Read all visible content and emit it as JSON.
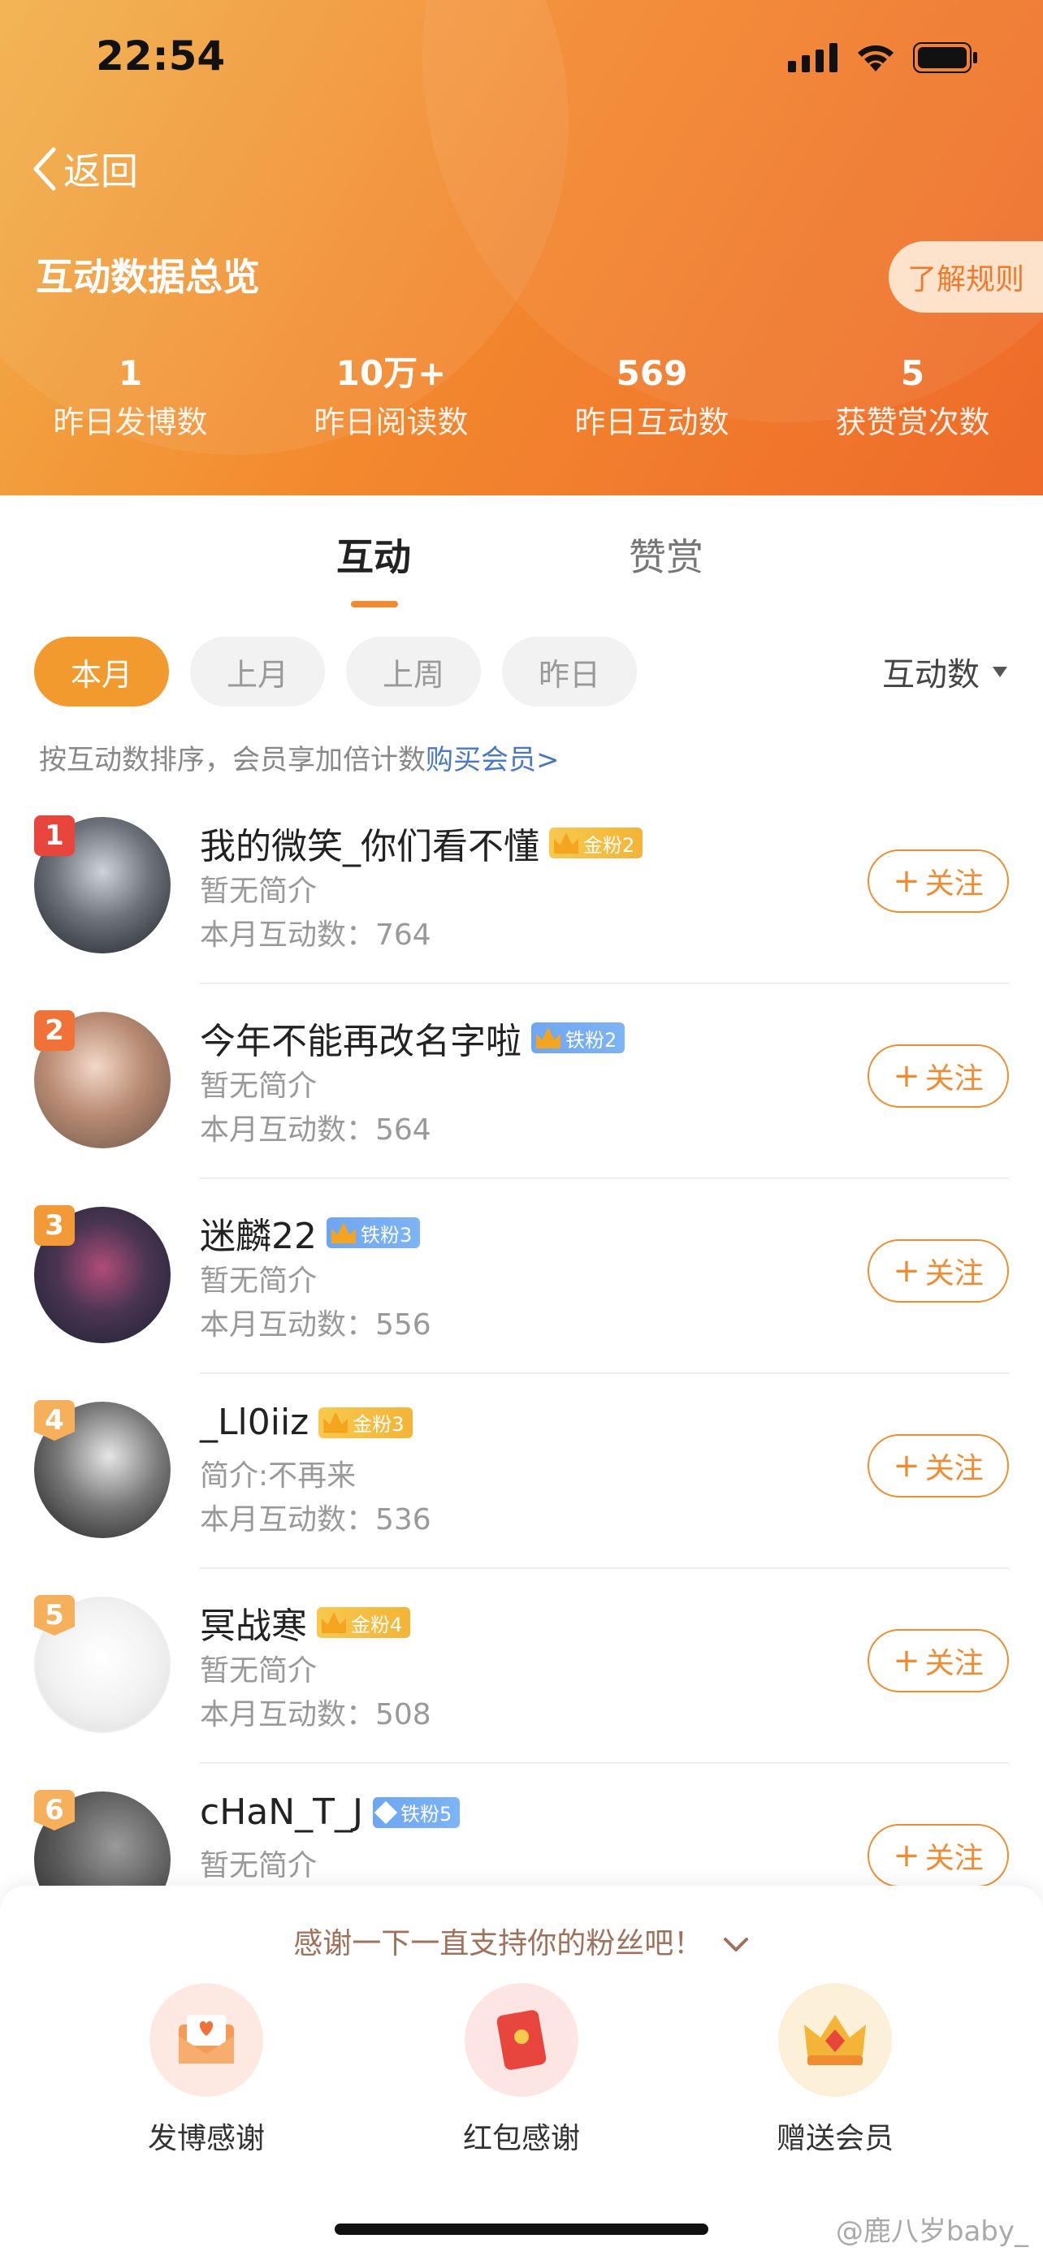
{
  "status_bar": {
    "time": "22:54"
  },
  "header": {
    "back_label": "返回",
    "title": "互动数据总览",
    "rules_button": "了解规则",
    "stats": [
      {
        "value": "1",
        "label": "昨日发博数"
      },
      {
        "value": "10万+",
        "label": "昨日阅读数"
      },
      {
        "value": "569",
        "label": "昨日互动数"
      },
      {
        "value": "5",
        "label": "获赞赏次数"
      }
    ]
  },
  "tabs": [
    {
      "label": "互动",
      "active": true
    },
    {
      "label": "赞赏",
      "active": false
    }
  ],
  "filters": {
    "options": [
      "本月",
      "上月",
      "上周",
      "昨日"
    ],
    "selected": "本月"
  },
  "sort": {
    "label": "互动数"
  },
  "hint": {
    "text": "按互动数排序，会员享加倍计数",
    "link": "购买会员>"
  },
  "fans": [
    {
      "rank": "1",
      "name": "我的微笑_你们看不懂",
      "badge": "金粉2",
      "badge_type": "gold",
      "bio": "暂无简介",
      "count": "本月互动数：764",
      "follow": "关注"
    },
    {
      "rank": "2",
      "name": "今年不能再改名字啦",
      "badge": "铁粉2",
      "badge_type": "iron",
      "bio": "暂无简介",
      "count": "本月互动数：564",
      "follow": "关注"
    },
    {
      "rank": "3",
      "name": "迷麟22",
      "badge": "铁粉3",
      "badge_type": "iron",
      "bio": "暂无简介",
      "count": "本月互动数：556",
      "follow": "关注"
    },
    {
      "rank": "4",
      "name": "_Ll0iiz",
      "badge": "金粉3",
      "badge_type": "gold",
      "bio": "简介:不再来",
      "count": "本月互动数：536",
      "follow": "关注"
    },
    {
      "rank": "5",
      "name": "冥战寒",
      "badge": "金粉4",
      "badge_type": "gold",
      "bio": "暂无简介",
      "count": "本月互动数：508",
      "follow": "关注"
    },
    {
      "rank": "6",
      "name": "cHaN_T_J",
      "badge": "铁粉5",
      "badge_type": "iron",
      "bio": "暂无简介",
      "count": "",
      "follow": "关注"
    }
  ],
  "bottom_panel": {
    "thanks_text": "感谢一下一直支持你的粉丝吧！",
    "actions": [
      {
        "label": "发博感谢",
        "icon": "envelope-heart-icon"
      },
      {
        "label": "红包感谢",
        "icon": "red-envelope-icon"
      },
      {
        "label": "赠送会员",
        "icon": "crown-gift-icon"
      }
    ]
  },
  "watermark": "@鹿八岁baby_",
  "colors": {
    "accent": "#f08c30",
    "header_start": "#f2b04a",
    "header_end": "#ee6a2a",
    "gold_badge": "#f3b437",
    "iron_badge": "#6fa6f2"
  }
}
